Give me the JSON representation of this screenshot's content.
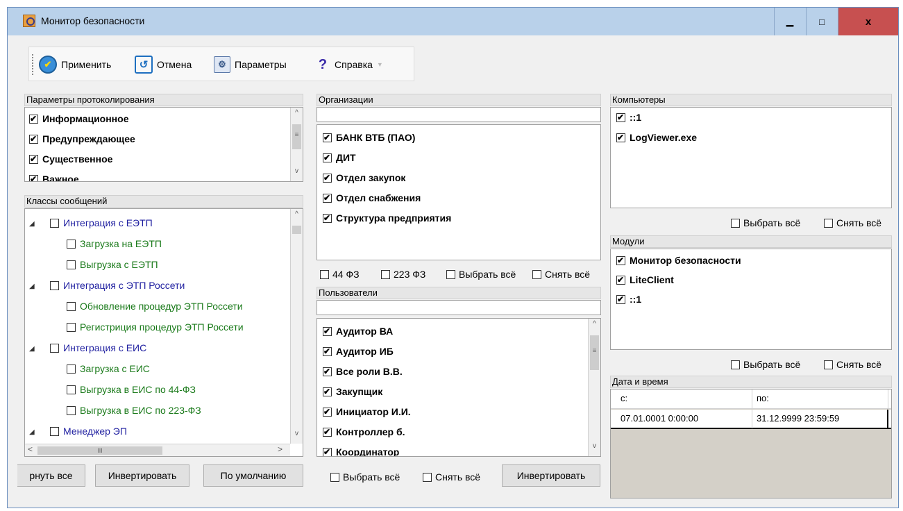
{
  "window": {
    "title": "Монитор безопасности",
    "icon": "magnifier-app-icon",
    "controls": {
      "minimize": "▁",
      "maximize": "□",
      "close": "x"
    }
  },
  "toolbar": {
    "apply": "Применить",
    "cancel": "Отмена",
    "params": "Параметры",
    "help": "Справка",
    "help_arrow": "▼"
  },
  "log_params": {
    "header": "Параметры протоколирования",
    "items": [
      "Информационное",
      "Предупреждающее",
      "Существенное",
      "Важное"
    ]
  },
  "message_classes": {
    "header": "Классы сообщений",
    "items": [
      {
        "label": "Интеграция с ЕЭТП",
        "level": 0,
        "expander": "◢"
      },
      {
        "label": "Загрузка на ЕЭТП",
        "level": 1
      },
      {
        "label": "Выгрузка с ЕЭТП",
        "level": 1
      },
      {
        "label": "Интеграция с ЭТП Россети",
        "level": 0,
        "expander": "◢"
      },
      {
        "label": "Обновление процедур ЭТП Россети",
        "level": 1
      },
      {
        "label": "Регистриция процедур ЭТП Россети",
        "level": 1
      },
      {
        "label": "Интеграция с ЕИС",
        "level": 0,
        "expander": "◢"
      },
      {
        "label": "Загрузка с ЕИС",
        "level": 1
      },
      {
        "label": "Выгрузка в ЕИС по 44-ФЗ",
        "level": 1
      },
      {
        "label": "Выгрузка в ЕИС по 223-ФЗ",
        "level": 1
      },
      {
        "label": "Менеджер ЭП",
        "level": 0,
        "expander": "◢"
      }
    ],
    "hscroll_grip": "III",
    "buttons": {
      "collapse_all": "рнуть все",
      "invert": "Инвертировать",
      "default": "По умолчанию"
    }
  },
  "organizations": {
    "header": "Организации",
    "items": [
      "БАНК ВТБ (ПАО)",
      "ДИТ",
      "Отдел закупок",
      "Отдел снабжения",
      "Структура предприятия"
    ],
    "filters": {
      "fz44": "44 ФЗ",
      "fz223": "223 ФЗ",
      "select_all": "Выбрать всё",
      "clear_all": "Снять всё"
    }
  },
  "users": {
    "header": "Пользователи",
    "items": [
      "Аудитор ВА",
      "Аудитор ИБ",
      "Все роли В.В.",
      "Закупщик",
      "Инициатор И.И.",
      "Контроллер б.",
      "Координатор"
    ],
    "buttons": {
      "select_all": "Выбрать всё",
      "clear_all": "Снять всё",
      "invert": "Инвертировать"
    }
  },
  "computers": {
    "header": "Компьютеры",
    "items": [
      "::1",
      "LogViewer.exe"
    ],
    "select_all": "Выбрать всё",
    "clear_all": "Снять всё"
  },
  "modules": {
    "header": "Модули",
    "items": [
      "Монитор безопасности",
      "LiteClient",
      "::1"
    ],
    "select_all": "Выбрать всё",
    "clear_all": "Снять всё"
  },
  "datetime": {
    "header": "Дата и время",
    "col_from": "с:",
    "col_to": "по:",
    "from": "07.01.0001 0:00:00",
    "to": "31.12.9999 23:59:59"
  },
  "scroll": {
    "up": "^",
    "down": "v",
    "left": "<",
    "right": ">",
    "grip": "≡"
  }
}
